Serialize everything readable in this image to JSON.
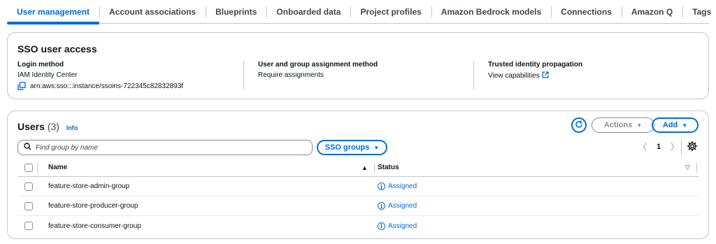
{
  "tabs": [
    {
      "label": "User management",
      "active": true
    },
    {
      "label": "Account associations",
      "active": false
    },
    {
      "label": "Blueprints",
      "active": false
    },
    {
      "label": "Onboarded data",
      "active": false
    },
    {
      "label": "Project profiles",
      "active": false
    },
    {
      "label": "Amazon Bedrock models",
      "active": false
    },
    {
      "label": "Connections",
      "active": false
    },
    {
      "label": "Amazon Q",
      "active": false
    },
    {
      "label": "Tags",
      "active": false
    }
  ],
  "sso": {
    "title": "SSO user access",
    "login_method": {
      "label": "Login method",
      "value": "IAM Identity Center",
      "arn": "arn:aws:sso:::instance/ssoins-722345c82832893f"
    },
    "assignment": {
      "label": "User and group assignment method",
      "value": "Require assignments"
    },
    "propagation": {
      "label": "Trusted identity propagation",
      "link": "View capabilities"
    }
  },
  "users": {
    "title": "Users",
    "count": "(3)",
    "info": "Info",
    "actions_label": "Actions",
    "add_label": "Add",
    "search_placeholder": "Find group by name",
    "filter_label": "SSO groups",
    "page": "1",
    "columns": {
      "name": "Name",
      "status": "Status"
    },
    "rows": [
      {
        "name": "feature-store-admin-group",
        "status": "Assigned"
      },
      {
        "name": "feature-store-producer-group",
        "status": "Assigned"
      },
      {
        "name": "feature-store-consumer-group",
        "status": "Assigned"
      }
    ]
  },
  "colors": {
    "accent": "#006ce0",
    "border": "#c6c6cd",
    "text": "#0f141a",
    "disabled": "#8c8c94"
  },
  "icons": [
    "copy-icon",
    "external-link-icon",
    "refresh-icon",
    "search-icon",
    "chevron-left-icon",
    "chevron-right-icon",
    "gear-icon",
    "info-icon",
    "sort-ascending-icon",
    "sort-descending-icon"
  ]
}
